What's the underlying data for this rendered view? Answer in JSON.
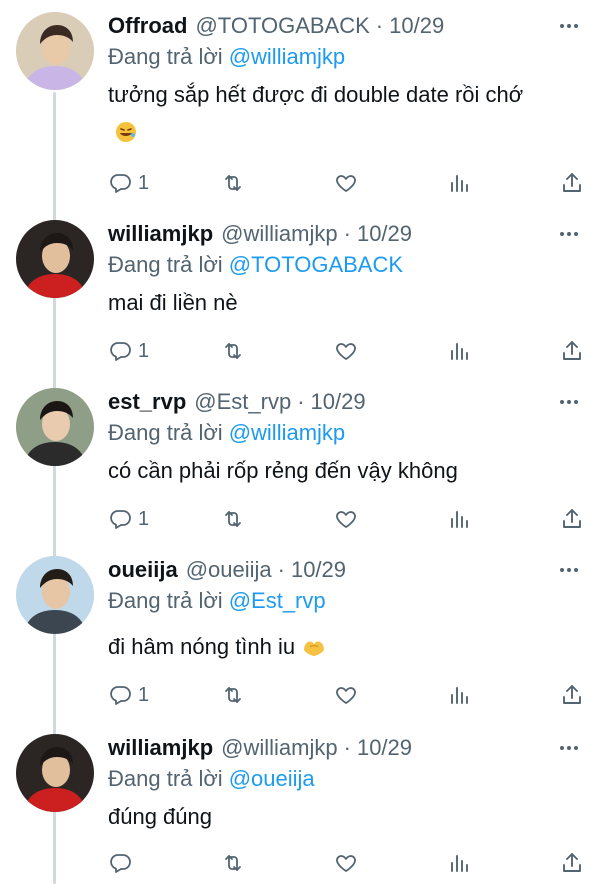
{
  "reply_prefix": "Đang trả lời",
  "tweets": [
    {
      "name": "Offroad",
      "handle": "@TOTOGABACK",
      "date": "10/29",
      "reply_to": "@williamjkp",
      "text": "tưởng sắp hết được đi double date rồi chớ",
      "emoji": "rolling-laughing-emoji",
      "reply_count": "1",
      "avatar_colors": {
        "bg": "#d9cdb8",
        "skin": "#e8c9a8",
        "hair": "#3a2a22",
        "shirt": "#c9b6e6"
      }
    },
    {
      "name": "williamjkp",
      "handle": "@williamjkp",
      "date": "10/29",
      "reply_to": "@TOTOGABACK",
      "text": "mai đi liền nè",
      "reply_count": "1",
      "avatar_colors": {
        "bg": "#2b2623",
        "skin": "#e2bf9c",
        "hair": "#1d1815",
        "shirt": "#cc1f1f"
      }
    },
    {
      "name": "est_rvp",
      "handle": "@Est_rvp",
      "date": "10/29",
      "reply_to": "@williamjkp",
      "text": "có cần phải rốp rẻng đến vậy không",
      "reply_count": "1",
      "avatar_colors": {
        "bg": "#8f9e86",
        "skin": "#e9cbb0",
        "hair": "#1a1613",
        "shirt": "#2b2b2b"
      }
    },
    {
      "name": "oueiija",
      "handle": "@oueiija",
      "date": "10/29",
      "reply_to": "@Est_rvp",
      "text": "đi hâm nóng tình iu",
      "emoji": "heart-hands-emoji",
      "reply_count": "1",
      "avatar_colors": {
        "bg": "#bfd8ea",
        "skin": "#e7c6a6",
        "hair": "#241c17",
        "shirt": "#3b4650"
      }
    },
    {
      "name": "williamjkp",
      "handle": "@williamjkp",
      "date": "10/29",
      "reply_to": "@oueiija",
      "text": "đúng đúng",
      "reply_count": "",
      "avatar_colors": {
        "bg": "#2b2623",
        "skin": "#e2bf9c",
        "hair": "#1d1815",
        "shirt": "#cc1f1f"
      }
    }
  ],
  "colors": {
    "link": "#1d9bf0",
    "muted": "#536471",
    "text": "#0f1419",
    "thread_line": "#cfd9de"
  }
}
